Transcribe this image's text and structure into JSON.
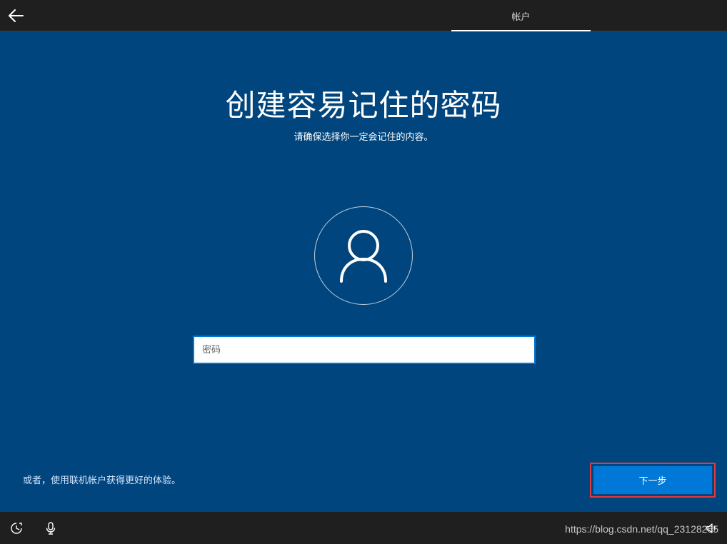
{
  "topbar": {
    "back_icon": "arrow-left-icon",
    "active_tab": "帐户"
  },
  "main": {
    "title": "创建容易记住的密码",
    "subtitle": "请确保选择你一定会记住的内容。",
    "avatar_icon": "user-icon",
    "password_placeholder": "密码",
    "online_account_link": "或者，使用联机帐户获得更好的体验。",
    "next_button": "下一步"
  },
  "bottombar": {
    "ease_of_access_icon": "ease-of-access-icon",
    "microphone_icon": "microphone-icon",
    "volume_icon": "volume-icon",
    "watermark": "https://blog.csdn.net/qq_23128265"
  },
  "colors": {
    "background": "#00457d",
    "bar": "#1f1f1f",
    "accent": "#0078d7",
    "highlight": "#e03a3e"
  }
}
